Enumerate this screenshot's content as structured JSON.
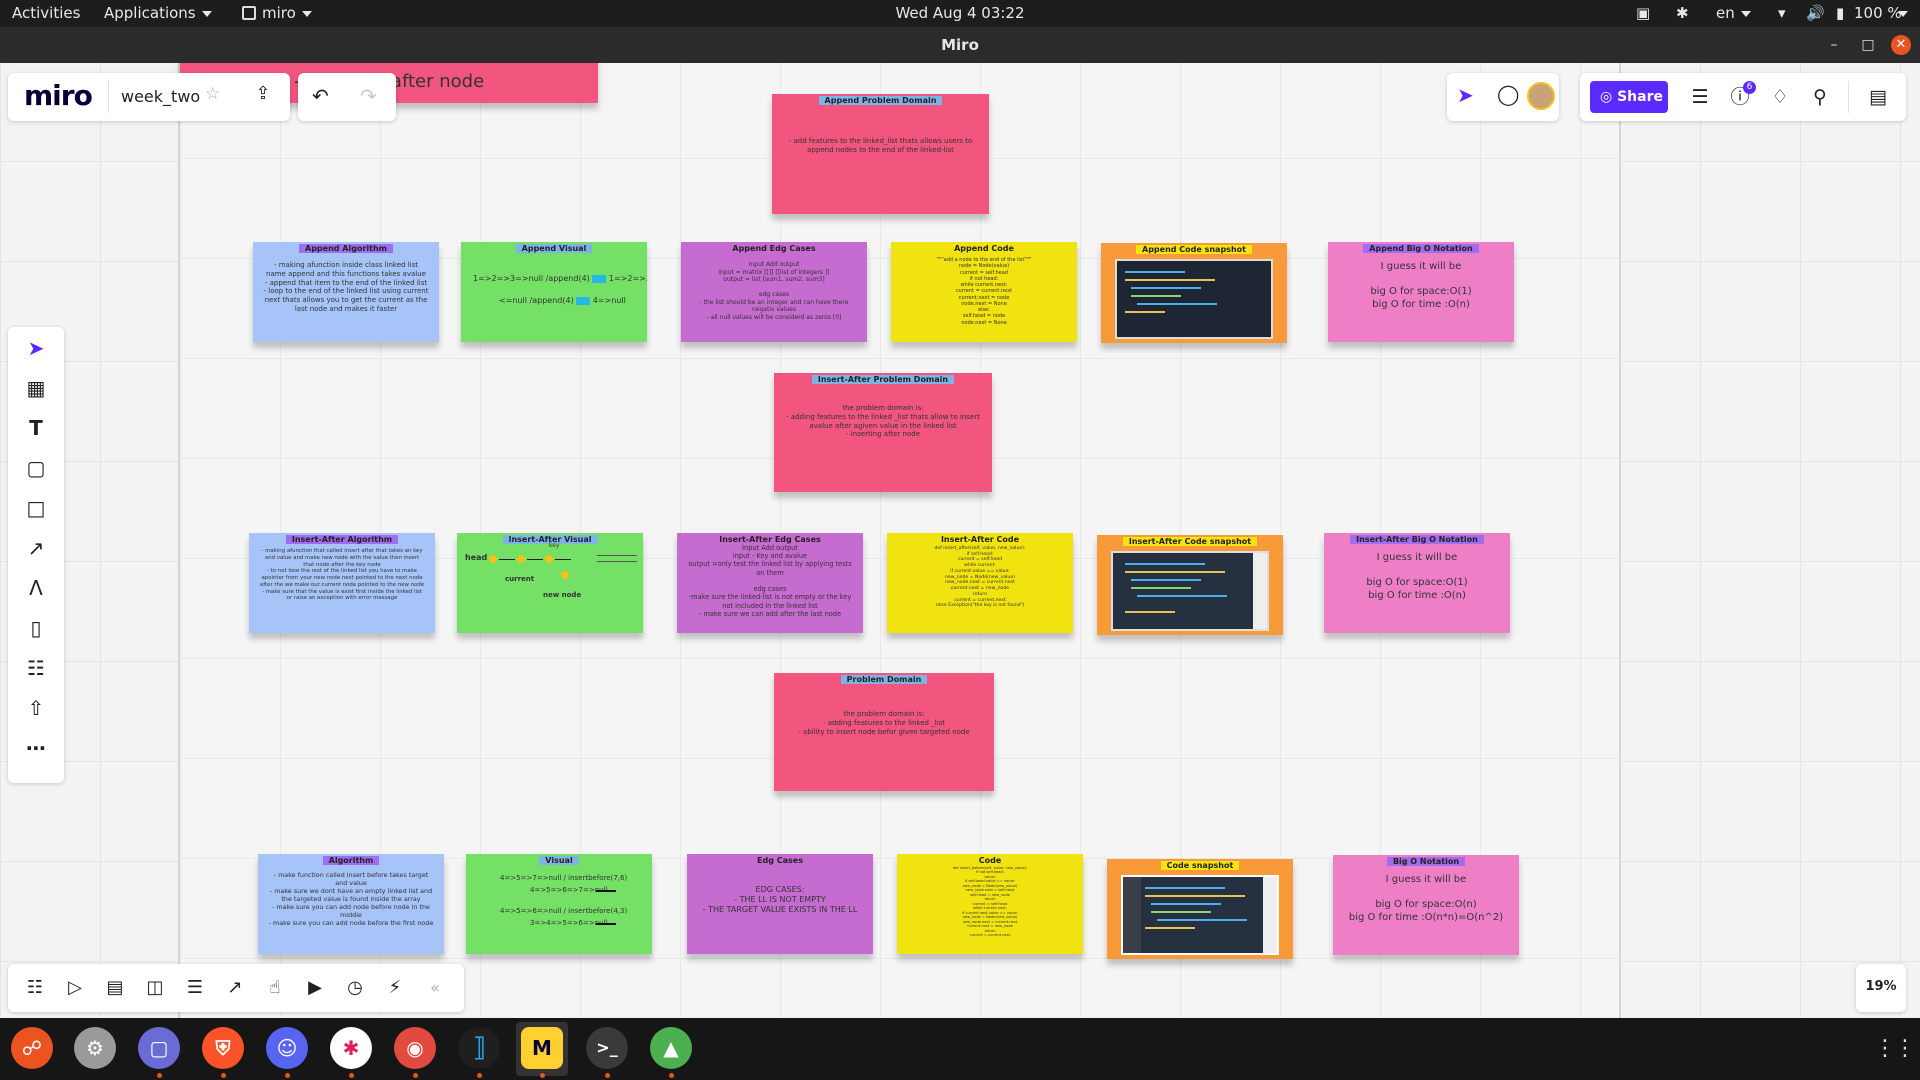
{
  "system": {
    "activities": "Activities",
    "applications": "Applications",
    "app_menu": "miro",
    "datetime": "Wed Aug 4  03:22",
    "lang": "en",
    "battery": "100 %"
  },
  "window": {
    "title": "Miro"
  },
  "miro": {
    "logo": "miro",
    "board_name": "week_two",
    "share_label": "Share",
    "help_badge": "6",
    "zoom": "19%"
  },
  "notes": {
    "top_partial": "- inserting after node",
    "append_domain": {
      "title": "Append Problem Domain",
      "body": "- add features to the linked_list thats allows users to append nodes to the end of the linked-list"
    },
    "append_algorithm": {
      "title": "Append Algorithm",
      "body": "- making afunction inside class linked list name append and this functions takes avalue\n- append that item to the end of the linked list\n- loop to the end of the linked list using current next thats allows you to get the current as the last node and makes it faster"
    },
    "append_visual": {
      "title": "Append Visual",
      "line1": "1=>2=>3=>null /append(4)",
      "line1b": "1=>2=>3=>4=>null",
      "line2": "<=null /append(4)",
      "line2b": "4=>null"
    },
    "append_edge": {
      "title": "Append Edg Cases",
      "body": "Input Add output\ninput = matrix [[]] [[list of integers ]]\noutput = list [sum1, sum2, sum3]\n\nedg cases\n- the list should be an integer and can have there negativ values\n- all null values will be considerd as zeros [0]"
    },
    "append_code": {
      "title": "Append Code",
      "body": "\"\"\"add a node to the end of the list\"\"\"\nnode = Node(value)\ncurrent = self.head\nif not head:\nwhile current.next:\ncurrent = current.next\ncurrent.next = node\nnode.next = None\nelse:\nself.head = node\nnode.next = None"
    },
    "append_snapshot": {
      "title": "Append Code snapshot"
    },
    "append_bigo": {
      "title": "Append Big O Notation",
      "body": "I guess it will be\n\nbig O for space:O(1)\nbig O for time :O(n)"
    },
    "insert_after_domain": {
      "title": "Insert-After Problem Domain",
      "body": "the problem domain is:\n- adding features to the linked _list thats allow to insert avalue after agiven value in the linked list\n- inserting after node"
    },
    "insert_after_algorithm": {
      "title": "Insert-After Algorithm",
      "body": "- making afunction that called insert after that takes an key and value and make new node with the value then insert that node after the key node\n- to not lose the rest of the linked list you have to make apointer from your new node next pointed to the next node\nafter the we make our current node pointed to the new node\n- make sure that the value is exist first inside the linked list or raise an exception with error massage"
    },
    "insert_after_visual": {
      "title": "Insert-After Visual",
      "key": "key",
      "head": "head",
      "current": "current",
      "new_node": "new node"
    },
    "insert_after_edge": {
      "title": "Insert-After Edg Cases",
      "body": "Input Add output\ninput - Key and avalue\noutput =only test the linked list by applying tests on them\n\nedg cases\n-make sure the linked-list is not empty or the key not included in the linked list\n- make sure we can add after the last node"
    },
    "insert_after_code": {
      "title": "Insert-After Code",
      "body": "def insert_after(self, value, new_value):\nif self.head:\ncurrent = self.head\nwhile current:\nif current.value == value:\nnew_node = Node(new_value)\nnew_node.next = current.next\ncurrent.next = new_node\nreturn\ncurrent = current.next\nraise Exception(\"the key is not found\")"
    },
    "insert_after_snapshot": {
      "title": "Insert-After Code snapshot"
    },
    "insert_after_bigo": {
      "title": "Insert-After Big O Notation",
      "body": "I guess it will be\n\nbig O for space:O(1)\nbig O for time :O(n)"
    },
    "domain": {
      "title": "Problem Domain",
      "body": "the problem domain is:\n- adding features to the linked _list\n- ability to insert node befor given targeted node"
    },
    "algorithm": {
      "title": "Algorithm",
      "body": "- make function called insert before takes target and value\n- make sure we dont have an empty linked list and the targeted value is found inside the array\n- make sure you can add node before node in the middle\n- make sure you can add node before the first node"
    },
    "visual": {
      "title": "Visual",
      "line1": "4=>5=>7=>null / insertbefore(7,6)",
      "line1b": "4=>5=>6=>7=>null",
      "line2": "4=>5=>6=>null / insertbefore(4,3)",
      "line2b": "3=>4=>5=>6=>null"
    },
    "edge": {
      "title": "Edg Cases",
      "body": "EDG CASES:\n- THE LL IS NOT EMPTY\n- THE TARGET VALUE EXISTS IN THE  LL"
    },
    "code": {
      "title": "Code",
      "body": "def insert_before(self, value, new_value):\nif not self.head:\nreturn\nif self.head.value == value:\nnew_node = Node(new_value)\nnew_node.next = self.head\nself.head = new_node\nreturn\ncurrent = self.head\nwhile current.next:\nif current.next.value == value:\nnew_node = Node(new_value)\nnew_node.next = current.next\ncurrent.next = new_node\nreturn\ncurrent = current.next"
    },
    "snapshot": {
      "title": "Code snapshot"
    },
    "bigo": {
      "title": "Big O Notation",
      "body": "I guess it will be\n\nbig O for space:O(n)\nbig O for time :O(n*n)=O(n^2)"
    }
  },
  "colors": {
    "accent": "#5b2aff",
    "ubuntu_orange": "#e95420"
  }
}
